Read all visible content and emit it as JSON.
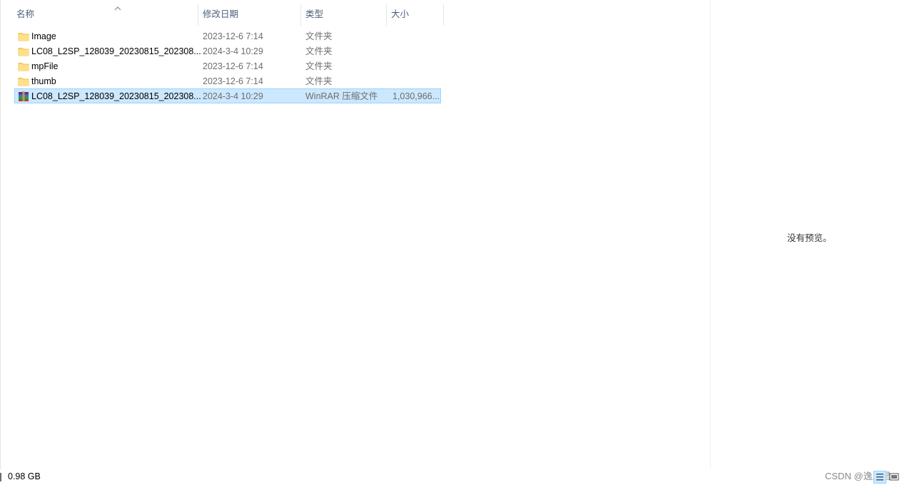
{
  "columns": {
    "name": "名称",
    "date": "修改日期",
    "type": "类型",
    "size": "大小"
  },
  "sort": {
    "column": "name",
    "direction": "ascending"
  },
  "files": [
    {
      "name": "Image",
      "date": "2023-12-6 7:14",
      "type": "文件夹",
      "size": "",
      "icon": "folder-icon",
      "selected": false
    },
    {
      "name": "LC08_L2SP_128039_20230815_202308...",
      "date": "2024-3-4 10:29",
      "type": "文件夹",
      "size": "",
      "icon": "folder-icon",
      "selected": false
    },
    {
      "name": "mpFile",
      "date": "2023-12-6 7:14",
      "type": "文件夹",
      "size": "",
      "icon": "folder-icon",
      "selected": false
    },
    {
      "name": "thumb",
      "date": "2023-12-6 7:14",
      "type": "文件夹",
      "size": "",
      "icon": "folder-icon",
      "selected": false
    },
    {
      "name": "LC08_L2SP_128039_20230815_202308...",
      "date": "2024-3-4 10:29",
      "type": "WinRAR 压缩文件",
      "size": "1,030,966...",
      "icon": "winrar-archive-icon",
      "selected": true
    }
  ],
  "preview": {
    "message": "没有预览。"
  },
  "status": {
    "selected_size": "0.98 GB",
    "watermark": "CSDN @逸辰君"
  },
  "colors": {
    "selection_bg": "#cce8ff",
    "selection_border": "#99d1ff",
    "header_text": "#4c607a",
    "secondary_text": "#6d6d6d",
    "folder": "#ffd766"
  }
}
